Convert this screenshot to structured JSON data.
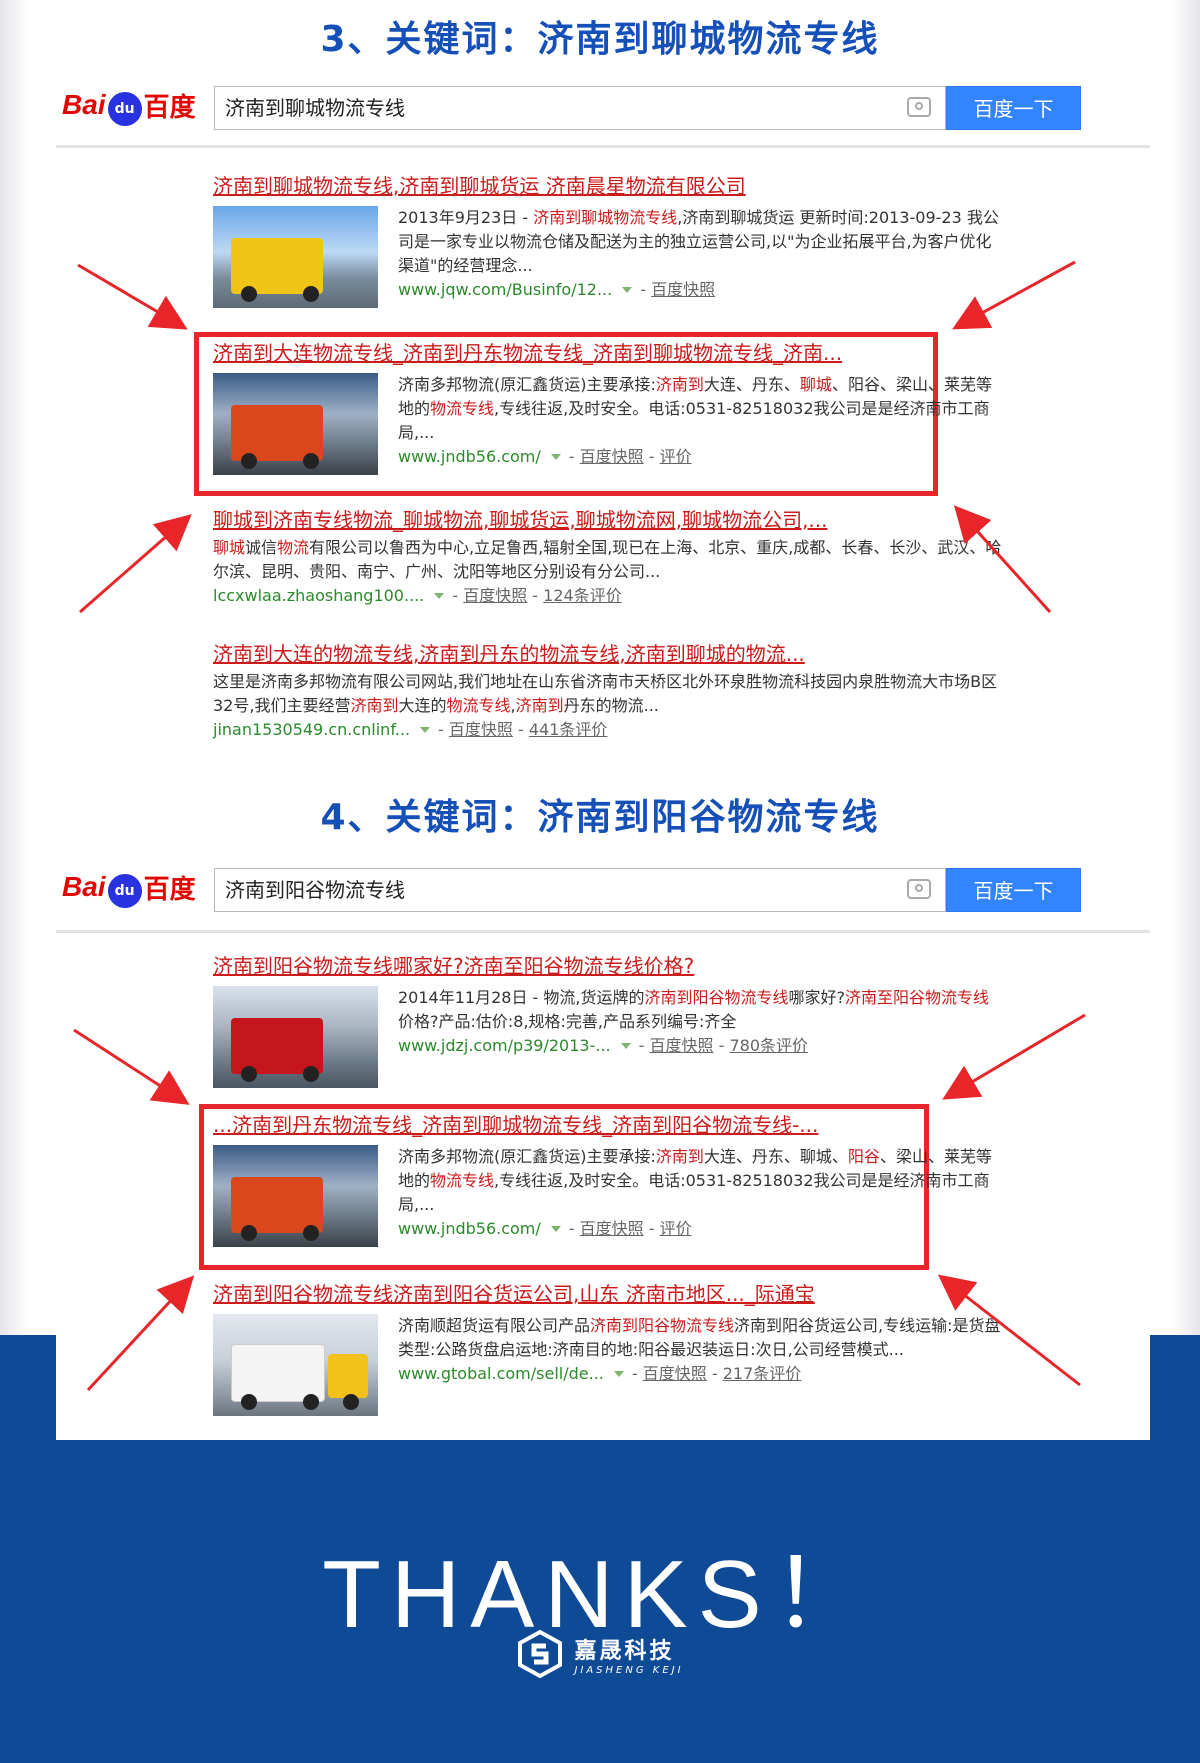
{
  "colors": {
    "title_blue": "#1550b8",
    "result_red": "#cc1b1b",
    "url_green": "#2b8a2b",
    "baidu_blue": "#3385ff",
    "highlight_box": "#e8262a",
    "footer_blue": "#0f4a96"
  },
  "section1": {
    "heading": "3、关键词：济南到聊城物流专线",
    "logo": {
      "bai": "Bai",
      "paw": "du",
      "du": "百度"
    },
    "search_value": "济南到聊城物流专线",
    "search_button": "百度一下",
    "results": [
      {
        "title": "济南到聊城物流专线,济南到聊城货运 济南晨星物流有限公司",
        "text_parts": [
          "2013年9月23日 - ",
          "济南到聊城物流专线",
          ",济南到聊城货运 更新时间:2013-09-23 我公司是一家专业以物流仓储及配送为主的独立运营公司,以\"为企业拓展平台,为客户优化渠道\"的经营理念..."
        ],
        "url": "www.jqw.com/Businfo/12...",
        "links": [
          "百度快照"
        ]
      },
      {
        "title": "济南到大连物流专线_济南到丹东物流专线_济南到聊城物流专线_济南...",
        "text_parts": [
          "济南多邦物流(原汇鑫货运)主要承接:",
          "济南到",
          "大连、丹东、",
          "聊城",
          "、阳谷、梁山、莱芜等地的",
          "物流专线",
          ",专线往返,及时安全。电话:0531-82518032我公司是是经济南市工商局,..."
        ],
        "url": "www.jndb56.com/",
        "links": [
          "百度快照",
          "评价"
        ]
      },
      {
        "title": "聊城到济南专线物流_聊城物流,聊城货运,聊城物流网,聊城物流公司,...",
        "text_parts": [
          "聊城",
          "诚信",
          "物流",
          "有限公司以鲁西为中心,立足鲁西,辐射全国,现已在上海、北京、重庆,成都、长春、长沙、武汉、哈尔滨、昆明、贵阳、南宁、广州、沈阳等地区分别设有分公司..."
        ],
        "url": "lccxwlaa.zhaoshang100....",
        "links": [
          "百度快照",
          "124条评价"
        ]
      },
      {
        "title": "济南到大连的物流专线,济南到丹东的物流专线,济南到聊城的物流...",
        "text_parts": [
          "这里是济南多邦物流有限公司网站,我们地址在山东省济南市天桥区北外环泉胜物流科技园内泉胜物流大市场B区32号,我们主要经营",
          "济南到",
          "大连的",
          "物流专线",
          ",",
          "济南到",
          "丹东的物流..."
        ],
        "url": "jinan1530549.cn.cnlinf...",
        "links": [
          "百度快照",
          "441条评价"
        ]
      }
    ]
  },
  "section2": {
    "heading": "4、关键词：济南到阳谷物流专线",
    "logo": {
      "bai": "Bai",
      "paw": "du",
      "du": "百度"
    },
    "search_value": "济南到阳谷物流专线",
    "search_button": "百度一下",
    "results": [
      {
        "title": "济南到阳谷物流专线哪家好?济南至阳谷物流专线价格?",
        "text_parts": [
          "2014年11月28日 - 物流,货运牌的",
          "济南到阳谷物流专线",
          "哪家好?",
          "济南至阳谷物流专线",
          "价格?产品:估价:8,规格:完善,产品系列编号:齐全"
        ],
        "url": "www.jdzj.com/p39/2013-...",
        "links": [
          "百度快照",
          "780条评价"
        ]
      },
      {
        "title": "...济南到丹东物流专线_济南到聊城物流专线_济南到阳谷物流专线-...",
        "text_parts": [
          "济南多邦物流(原汇鑫货运)主要承接:",
          "济南到",
          "大连、丹东、聊城、",
          "阳谷",
          "、梁山、莱芜等地的",
          "物流专线",
          ",专线往返,及时安全。电话:0531-82518032我公司是是经济南市工商局,..."
        ],
        "url": "www.jndb56.com/",
        "links": [
          "百度快照",
          "评价"
        ]
      },
      {
        "title": "济南到阳谷物流专线济南到阳谷货运公司,山东 济南市地区..._际通宝",
        "text_parts": [
          "济南顺超货运有限公司产品",
          "济南到阳谷物流专线",
          "济南到阳谷货运公司,专线运输:是货盘类型:公路货盘启运地:济南目的地:阳谷最迟装运日:次日,公司经营模式..."
        ],
        "url": "www.gtobal.com/sell/de...",
        "links": [
          "百度快照",
          "217条评价"
        ]
      }
    ]
  },
  "footer": {
    "thanks": "THANKS！",
    "brand_cn": "嘉晟科技",
    "brand_en": "JIASHENG KEJI"
  }
}
